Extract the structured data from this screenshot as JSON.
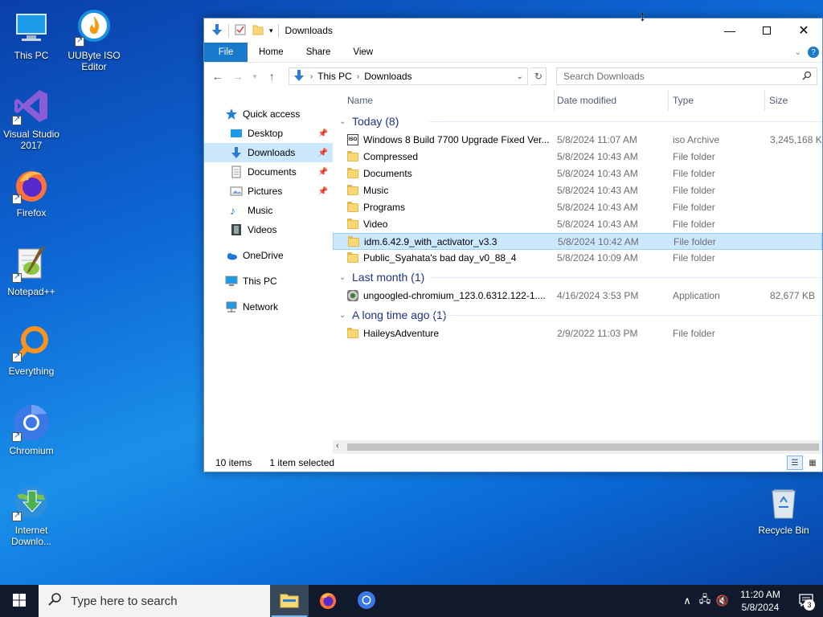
{
  "desktop": {
    "icons": [
      {
        "label": "This PC"
      },
      {
        "label": "UUByte ISO Editor"
      },
      {
        "label": "Visual Studio 2017"
      },
      {
        "label": "Firefox"
      },
      {
        "label": "Notepad++"
      },
      {
        "label": "Everything"
      },
      {
        "label": "Chromium"
      },
      {
        "label": "Internet Downlo..."
      },
      {
        "label": "Recycle Bin"
      }
    ]
  },
  "window": {
    "title": "Downloads",
    "ribbon_tabs": [
      "File",
      "Home",
      "Share",
      "View"
    ],
    "address": {
      "segments": [
        "This PC",
        "Downloads"
      ]
    },
    "search": {
      "placeholder": "Search Downloads"
    },
    "nav_pane": {
      "quick_access": "Quick access",
      "quick_items": [
        "Desktop",
        "Downloads",
        "Documents",
        "Pictures",
        "Music",
        "Videos"
      ],
      "onedrive": "OneDrive",
      "this_pc": "This PC",
      "network": "Network"
    },
    "columns": [
      "Name",
      "Date modified",
      "Type",
      "Size"
    ],
    "groups": [
      {
        "title": "Today (8)",
        "rows": [
          {
            "name": "Windows 8 Build 7700 Upgrade Fixed Ver...",
            "date": "5/8/2024 11:07 AM",
            "type": "iso Archive",
            "size": "3,245,168 KB",
            "icon": "iso-icon"
          },
          {
            "name": "Compressed",
            "date": "5/8/2024 10:43 AM",
            "type": "File folder",
            "size": "",
            "icon": "folder-icon"
          },
          {
            "name": "Documents",
            "date": "5/8/2024 10:43 AM",
            "type": "File folder",
            "size": "",
            "icon": "folder-icon"
          },
          {
            "name": "Music",
            "date": "5/8/2024 10:43 AM",
            "type": "File folder",
            "size": "",
            "icon": "folder-icon"
          },
          {
            "name": "Programs",
            "date": "5/8/2024 10:43 AM",
            "type": "File folder",
            "size": "",
            "icon": "folder-icon"
          },
          {
            "name": "Video",
            "date": "5/8/2024 10:43 AM",
            "type": "File folder",
            "size": "",
            "icon": "folder-icon"
          },
          {
            "name": "idm.6.42.9_with_activator_v3.3",
            "date": "5/8/2024 10:42 AM",
            "type": "File folder",
            "size": "",
            "icon": "folder-icon",
            "selected": true
          },
          {
            "name": "Public_Syahata's bad day_v0_88_4",
            "date": "5/8/2024 10:09 AM",
            "type": "File folder",
            "size": "",
            "icon": "folder-icon"
          }
        ]
      },
      {
        "title": "Last month (1)",
        "rows": [
          {
            "name": "ungoogled-chromium_123.0.6312.122-1....",
            "date": "4/16/2024 3:53 PM",
            "type": "Application",
            "size": "82,677 KB",
            "icon": "app-icon"
          }
        ]
      },
      {
        "title": "A long time ago (1)",
        "rows": [
          {
            "name": "HaileysAdventure",
            "date": "2/9/2022 11:03 PM",
            "type": "File folder",
            "size": "",
            "icon": "folder-icon"
          }
        ]
      }
    ],
    "status": {
      "count": "10 items",
      "selection": "1 item selected"
    }
  },
  "taskbar": {
    "search_placeholder": "Type here to search",
    "clock_time": "11:20 AM",
    "clock_date": "5/8/2024",
    "notification_count": "3"
  }
}
